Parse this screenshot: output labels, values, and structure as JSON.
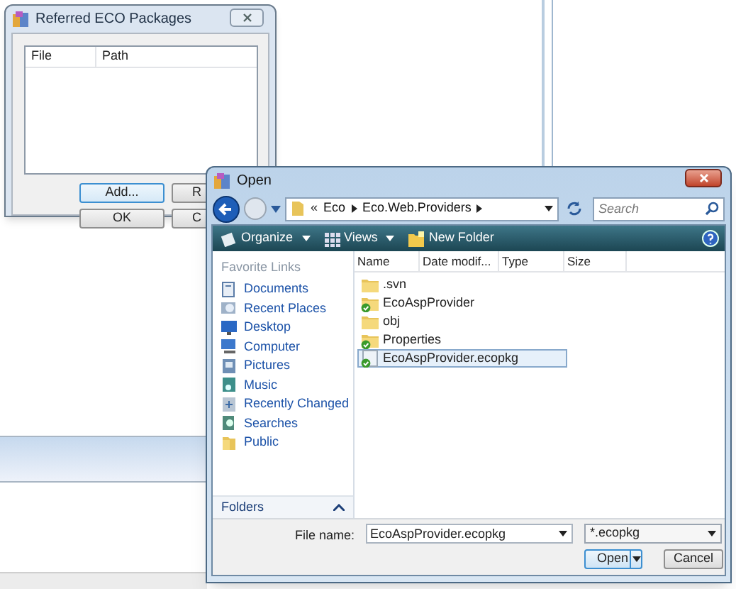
{
  "ref_window": {
    "title": "Referred ECO Packages",
    "columns": [
      "File",
      "Path"
    ],
    "buttons": [
      {
        "label": "Add...",
        "default": true
      },
      {
        "label": "R",
        "default": false
      },
      {
        "label": "OK",
        "default": false
      },
      {
        "label": "C",
        "default": false
      }
    ]
  },
  "open_dialog": {
    "title": "Open",
    "address": {
      "prefix": "«",
      "segments": [
        "Eco",
        "Eco.Web.Providers"
      ]
    },
    "search": {
      "placeholder": "Search"
    },
    "toolbar": [
      {
        "label": "Organize",
        "kind": "menu"
      },
      {
        "label": "Views",
        "kind": "views"
      },
      {
        "label": "New Folder",
        "kind": "new-folder"
      }
    ],
    "favorites_header": "Favorite Links",
    "favorites": [
      {
        "label": "Documents",
        "kind": "documents"
      },
      {
        "label": "Recent Places",
        "kind": "recent"
      },
      {
        "label": "Desktop",
        "kind": "desktop"
      },
      {
        "label": "Computer",
        "kind": "computer"
      },
      {
        "label": "Pictures",
        "kind": "pictures"
      },
      {
        "label": "Music",
        "kind": "music"
      },
      {
        "label": "Recently Changed",
        "kind": "changed"
      },
      {
        "label": "Searches",
        "kind": "searches"
      },
      {
        "label": "Public",
        "kind": "public"
      }
    ],
    "folders_label": "Folders",
    "columns": [
      "Name",
      "Date modif...",
      "Type",
      "Size"
    ],
    "files": [
      {
        "name": ".svn",
        "kind": "folder",
        "selected": false
      },
      {
        "name": "EcoAspProvider",
        "kind": "project-folder",
        "selected": false
      },
      {
        "name": "obj",
        "kind": "folder",
        "selected": false
      },
      {
        "name": "Properties",
        "kind": "project-folder",
        "selected": false
      },
      {
        "name": "EcoAspProvider.ecopkg",
        "kind": "package",
        "selected": true
      }
    ],
    "file_name_label": "File name:",
    "file_name": "EcoAspProvider.ecopkg",
    "filter": "*.ecopkg",
    "buttons": [
      {
        "label": "Open",
        "kind": "split"
      },
      {
        "label": "Cancel",
        "kind": "plain"
      }
    ]
  }
}
